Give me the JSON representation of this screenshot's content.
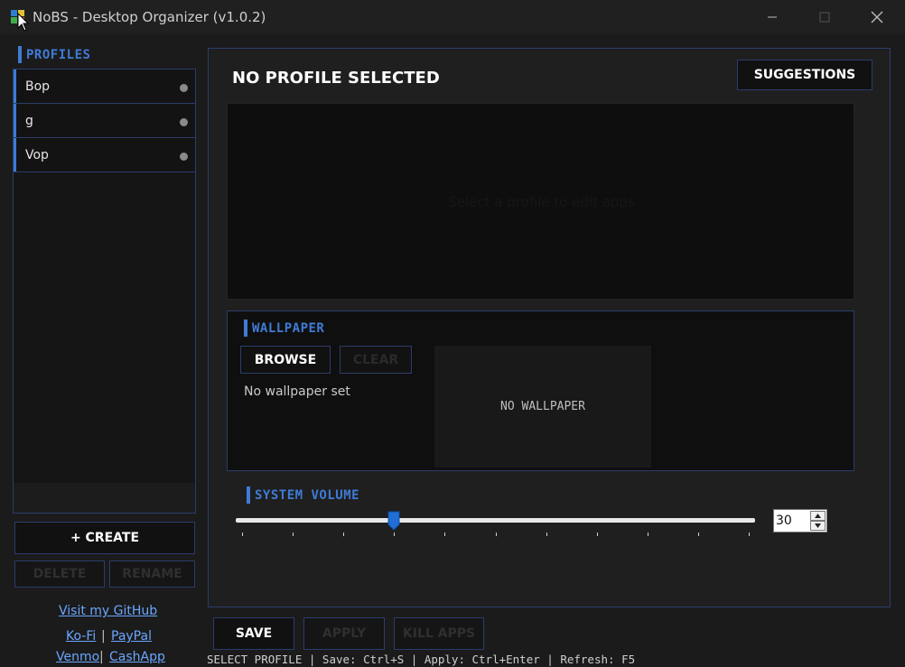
{
  "window": {
    "title": "NoBS - Desktop Organizer (v1.0.2)",
    "minimize_glyph": "—",
    "maximize_glyph": "☐",
    "close_glyph": "✕"
  },
  "sidebar": {
    "header": "PROFILES",
    "profiles": [
      {
        "name": "Bop"
      },
      {
        "name": "g"
      },
      {
        "name": "Vop"
      }
    ],
    "create_label": "+ CREATE",
    "delete_label": "DELETE",
    "rename_label": "RENAME",
    "links": {
      "github": "Visit my GitHub",
      "kofi": "Ko-Fi",
      "paypal": "PayPal",
      "venmo": "Venmo",
      "cashapp": "CashApp",
      "separator": "|"
    }
  },
  "main": {
    "profile_title": "NO PROFILE SELECTED",
    "suggestions_label": "SUGGESTIONS",
    "apps_placeholder": "Select a profile to edit apps",
    "wallpaper": {
      "header": "WALLPAPER",
      "browse_label": "BROWSE",
      "clear_label": "CLEAR",
      "status": "No wallpaper set",
      "preview_text": "NO WALLPAPER"
    },
    "volume": {
      "header": "SYSTEM VOLUME",
      "value": "30",
      "level_percent": 30
    }
  },
  "actions": {
    "save_label": "SAVE",
    "apply_label": "APPLY",
    "kill_label": "KILL APPS"
  },
  "status_bar": "SELECT PROFILE | Save: Ctrl+S | Apply: Ctrl+Enter | Refresh: F5",
  "colors": {
    "accent": "#3f7bd6",
    "background": "#1b1b1b",
    "link": "#6aa6ff"
  }
}
